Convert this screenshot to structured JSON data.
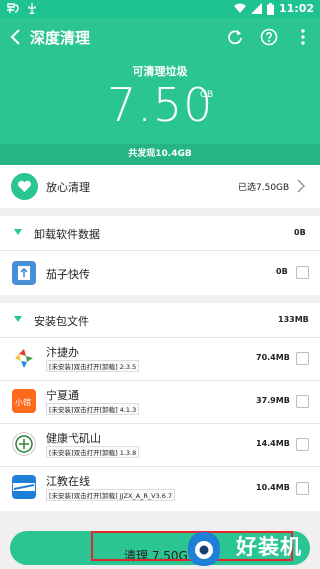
{
  "status_bar": {
    "time": "11:02"
  },
  "header": {
    "title": "深度清理",
    "summary_title": "可清理垃圾",
    "size_value": "7.50",
    "size_unit": "GB",
    "found_text": "共发现10.4GB"
  },
  "safe_clean": {
    "label": "放心清理",
    "value": "已选7.50GB"
  },
  "uninstall_section": {
    "label": "卸载软件数据",
    "size": "0B",
    "items": [
      {
        "name": "茄子快传",
        "size": "0B"
      }
    ]
  },
  "apk_section": {
    "label": "安装包文件",
    "size": "133MB",
    "items": [
      {
        "name": "汴捷办",
        "sub": "[未安装]双击打开[卸载] 2.3.5",
        "size": "70.4MB",
        "icon_color": "#ffffff"
      },
      {
        "name": "宁夏通",
        "sub": "[未安装]双击打开[卸载] 4.1.3",
        "size": "37.9MB",
        "icon_color": "#ff6a1a"
      },
      {
        "name": "健康弋矶山",
        "sub": "[未安装]双击打开[卸载] 1.3.8",
        "size": "14.4MB",
        "icon_color": "#ffffff"
      },
      {
        "name": "江教在线",
        "sub": "[未安装]双击打开[卸载] JJZX_A_R_V3.6.7",
        "size": "10.4MB",
        "icon_color": "#1d7fd6"
      }
    ]
  },
  "bottom": {
    "clean_button": "清理 7.50G"
  },
  "watermark": {
    "text": "好装机"
  },
  "colors": {
    "accent": "#2bc493",
    "highlight": "#e0282e"
  }
}
